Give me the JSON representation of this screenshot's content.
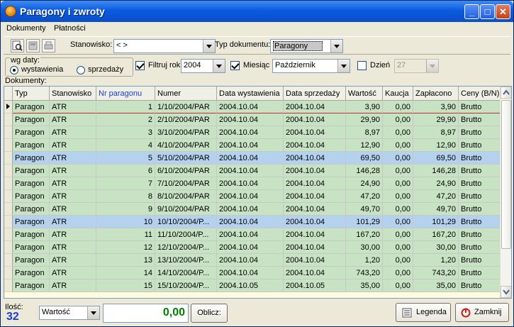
{
  "window": {
    "title": "Paragony i zwroty"
  },
  "menu": [
    "Dokumenty",
    "Płatności"
  ],
  "filters": {
    "stanowisko_label": "Stanowisko:",
    "stanowisko_value": "< >",
    "typ_label": "Typ dokumentu:",
    "typ_value": "Paragony",
    "wg_daty_label": "wg daty:",
    "radio_wystawienia": "wystawienia",
    "radio_sprzedazy": "sprzedaży",
    "filtruj_rok_label": "Filtruj rok",
    "rok_value": "2004",
    "miesiac_label": "Miesiąc",
    "miesiac_value": "Październik",
    "dzien_label": "Dzień",
    "dzien_value": "27"
  },
  "grid": {
    "section_label": "Dokumenty:",
    "columns": [
      "Typ",
      "Stanowisko",
      "Nr paragonu",
      "Numer",
      "Data wystawienia",
      "Data sprzedaży",
      "Wartość",
      "Kaucja",
      "Zapłacono",
      "Ceny (B/N)"
    ],
    "rows": [
      {
        "typ": "Paragon",
        "stanowisko": "ATR",
        "nr": "1",
        "numer": "1/10/2004/PAR",
        "data_wyst": "2004.10.04",
        "data_sprz": "2004.10.04",
        "wartosc": "3,90",
        "kaucja": "0,00",
        "zaplacono": "3,90",
        "ceny": "Brutto",
        "color": "#c8e2c4"
      },
      {
        "typ": "Paragon",
        "stanowisko": "ATR",
        "nr": "2",
        "numer": "2/10/2004/PAR",
        "data_wyst": "2004.10.04",
        "data_sprz": "2004.10.04",
        "wartosc": "29,90",
        "kaucja": "0,00",
        "zaplacono": "29,90",
        "ceny": "Brutto",
        "color": "#c8e2c4"
      },
      {
        "typ": "Paragon",
        "stanowisko": "ATR",
        "nr": "3",
        "numer": "3/10/2004/PAR",
        "data_wyst": "2004.10.04",
        "data_sprz": "2004.10.04",
        "wartosc": "8,97",
        "kaucja": "0,00",
        "zaplacono": "8,97",
        "ceny": "Brutto",
        "color": "#c8e2c4"
      },
      {
        "typ": "Paragon",
        "stanowisko": "ATR",
        "nr": "4",
        "numer": "4/10/2004/PAR",
        "data_wyst": "2004.10.04",
        "data_sprz": "2004.10.04",
        "wartosc": "12,90",
        "kaucja": "0,00",
        "zaplacono": "12,90",
        "ceny": "Brutto",
        "color": "#c8e2c4"
      },
      {
        "typ": "Paragon",
        "stanowisko": "ATR",
        "nr": "5",
        "numer": "5/10/2004/PAR",
        "data_wyst": "2004.10.04",
        "data_sprz": "2004.10.04",
        "wartosc": "69,50",
        "kaucja": "0,00",
        "zaplacono": "69,50",
        "ceny": "Brutto",
        "color": "#b4d2ee"
      },
      {
        "typ": "Paragon",
        "stanowisko": "ATR",
        "nr": "6",
        "numer": "6/10/2004/PAR",
        "data_wyst": "2004.10.04",
        "data_sprz": "2004.10.04",
        "wartosc": "146,28",
        "kaucja": "0,00",
        "zaplacono": "146,28",
        "ceny": "Brutto",
        "color": "#c8e2c4"
      },
      {
        "typ": "Paragon",
        "stanowisko": "ATR",
        "nr": "7",
        "numer": "7/10/2004/PAR",
        "data_wyst": "2004.10.04",
        "data_sprz": "2004.10.04",
        "wartosc": "24,90",
        "kaucja": "0,00",
        "zaplacono": "24,90",
        "ceny": "Brutto",
        "color": "#c8e2c4"
      },
      {
        "typ": "Paragon",
        "stanowisko": "ATR",
        "nr": "8",
        "numer": "8/10/2004/PAR",
        "data_wyst": "2004.10.04",
        "data_sprz": "2004.10.04",
        "wartosc": "47,20",
        "kaucja": "0,00",
        "zaplacono": "47,20",
        "ceny": "Brutto",
        "color": "#c8e2c4"
      },
      {
        "typ": "Paragon",
        "stanowisko": "ATR",
        "nr": "9",
        "numer": "9/10/2004/PAR",
        "data_wyst": "2004.10.04",
        "data_sprz": "2004.10.04",
        "wartosc": "49,70",
        "kaucja": "0,00",
        "zaplacono": "49,70",
        "ceny": "Brutto",
        "color": "#c8e2c4"
      },
      {
        "typ": "Paragon",
        "stanowisko": "ATR",
        "nr": "10",
        "numer": "10/10/2004/P...",
        "data_wyst": "2004.10.04",
        "data_sprz": "2004.10.04",
        "wartosc": "101,29",
        "kaucja": "0,00",
        "zaplacono": "101,29",
        "ceny": "Brutto",
        "color": "#b4d2ee"
      },
      {
        "typ": "Paragon",
        "stanowisko": "ATR",
        "nr": "11",
        "numer": "11/10/2004/P...",
        "data_wyst": "2004.10.04",
        "data_sprz": "2004.10.04",
        "wartosc": "167,20",
        "kaucja": "0,00",
        "zaplacono": "167,20",
        "ceny": "Brutto",
        "color": "#c8e2c4"
      },
      {
        "typ": "Paragon",
        "stanowisko": "ATR",
        "nr": "12",
        "numer": "12/10/2004/P...",
        "data_wyst": "2004.10.04",
        "data_sprz": "2004.10.04",
        "wartosc": "30,00",
        "kaucja": "0,00",
        "zaplacono": "30,00",
        "ceny": "Brutto",
        "color": "#c8e2c4"
      },
      {
        "typ": "Paragon",
        "stanowisko": "ATR",
        "nr": "13",
        "numer": "13/10/2004/P...",
        "data_wyst": "2004.10.04",
        "data_sprz": "2004.10.04",
        "wartosc": "1,20",
        "kaucja": "0,00",
        "zaplacono": "1,20",
        "ceny": "Brutto",
        "color": "#c8e2c4"
      },
      {
        "typ": "Paragon",
        "stanowisko": "ATR",
        "nr": "14",
        "numer": "14/10/2004/P...",
        "data_wyst": "2004.10.04",
        "data_sprz": "2004.10.04",
        "wartosc": "743,20",
        "kaucja": "0,00",
        "zaplacono": "743,20",
        "ceny": "Brutto",
        "color": "#c8e2c4"
      },
      {
        "typ": "Paragon",
        "stanowisko": "ATR",
        "nr": "15",
        "numer": "15/10/2004/P...",
        "data_wyst": "2004.10.05",
        "data_sprz": "2004.10.05",
        "wartosc": "35,00",
        "kaucja": "0,00",
        "zaplacono": "35,00",
        "ceny": "Brutto",
        "color": "#c8e2c4"
      }
    ]
  },
  "footer": {
    "ilosc_label": "Ilość:",
    "ilosc_value": "32",
    "aggregate_select": "Wartość",
    "sum_value": "0,00",
    "oblicz_label": "Oblicz:",
    "legenda_label": "Legenda",
    "zamknij_label": "Zamknij"
  },
  "colors": {
    "row_green": "#c8e2c4",
    "row_blue": "#b4d2ee",
    "sum_green": "#008000",
    "count_blue": "#1a3ccf"
  }
}
